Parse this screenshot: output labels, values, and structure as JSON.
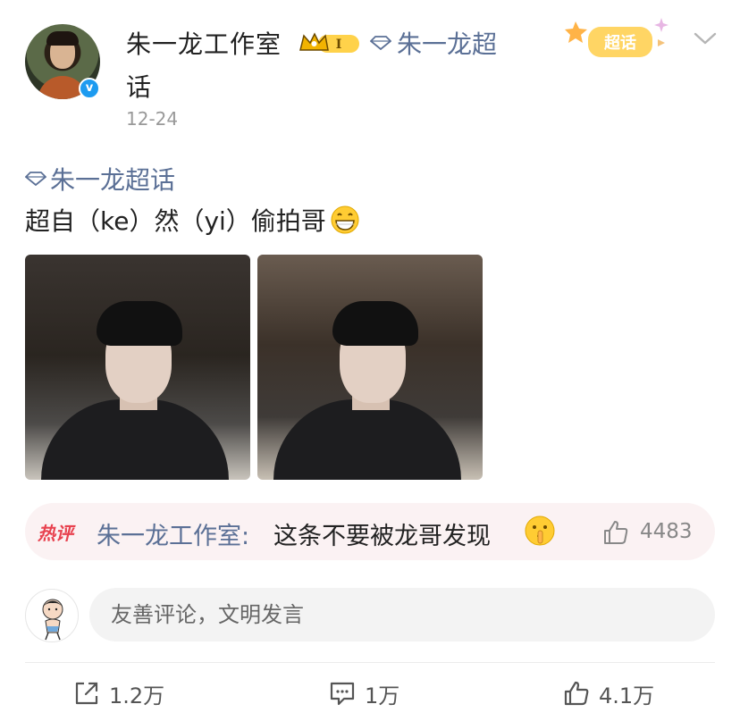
{
  "post": {
    "author": "朱一龙工作室",
    "author_wrap": "话",
    "super_topic": "朱一龙超",
    "time": "12-24",
    "chaohua_badge": "超话",
    "topic_link": "朱一龙超话",
    "text": "超自（ke）然（yi）偷拍哥",
    "badges": {
      "crown_level": "I"
    }
  },
  "hot_comment": {
    "tag": "热评",
    "author": "朱一龙工作室:",
    "text": "这条不要被龙哥发现",
    "likes": "4483"
  },
  "comment_box": {
    "placeholder": "友善评论，文明发言"
  },
  "actions": {
    "share": "1.2万",
    "comment": "1万",
    "like": "4.1万"
  },
  "icons": [
    "verified-icon",
    "crown-badge-icon",
    "diamond-icon",
    "chevron-down-icon",
    "grin-emoji",
    "shush-emoji",
    "thumbs-up-icon",
    "share-icon",
    "comment-icon"
  ],
  "colors": {
    "link": "#5b7096",
    "hot": "#e8424f",
    "verified": "#1d9bf0"
  }
}
